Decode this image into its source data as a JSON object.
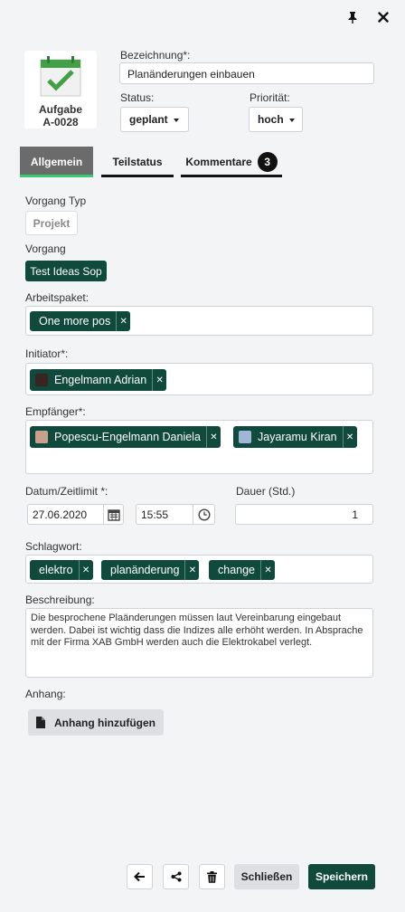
{
  "icons": {
    "pin": "pin-icon",
    "close": "close-icon"
  },
  "task": {
    "type_label": "Aufgabe",
    "id": "A-0028"
  },
  "bezeichnung": {
    "label": "Bezeichnung*:",
    "value": "Planänderungen einbauen"
  },
  "status": {
    "label": "Status:",
    "value": "geplant"
  },
  "prioritaet": {
    "label": "Priorität:",
    "value": "hoch"
  },
  "tabs": [
    {
      "label": "Allgemein",
      "active": true
    },
    {
      "label": "Teilstatus"
    },
    {
      "label": "Kommentare",
      "badge": "3"
    }
  ],
  "vorgang_typ": {
    "label": "Vorgang Typ",
    "value": "Projekt"
  },
  "vorgang": {
    "label": "Vorgang",
    "value": "Test Ideas Sop"
  },
  "arbeitspaket": {
    "label": "Arbeitspaket:",
    "chips": [
      "One more pos"
    ]
  },
  "initiator": {
    "label": "Initiator*:",
    "chips": [
      "Engelmann Adrian"
    ]
  },
  "empfaenger": {
    "label": "Empfänger*:",
    "chips": [
      "Popescu-Engelmann Daniela",
      "Jayaramu Kiran"
    ]
  },
  "datum": {
    "label": "Datum/Zeitlimit *:",
    "date": "27.06.2020",
    "time": "15:55"
  },
  "dauer": {
    "label": "Dauer (Std.)",
    "value": "1"
  },
  "schlagwort": {
    "label": "Schlagwort:",
    "chips": [
      "elektro",
      "planänderung",
      "change"
    ]
  },
  "beschreibung": {
    "label": "Beschreibung:",
    "value": "Die besprochene Plaänderungen müssen laut Vereinbarung eingebaut werden. Dabei ist wichtig dass die Indizes alle erhöht werden. In Absprache mit der Firma XAB GmbH werden auch die Elektrokabel verlegt."
  },
  "anhang": {
    "label": "Anhang:",
    "button": "Anhang hinzufügen"
  },
  "footer": {
    "close_label": "Schließen",
    "save_label": "Speichern"
  },
  "colors": {
    "accent": "#0f4a3c",
    "active_tab": "#6b6b6b",
    "tab_line_green": "#3ec774"
  }
}
